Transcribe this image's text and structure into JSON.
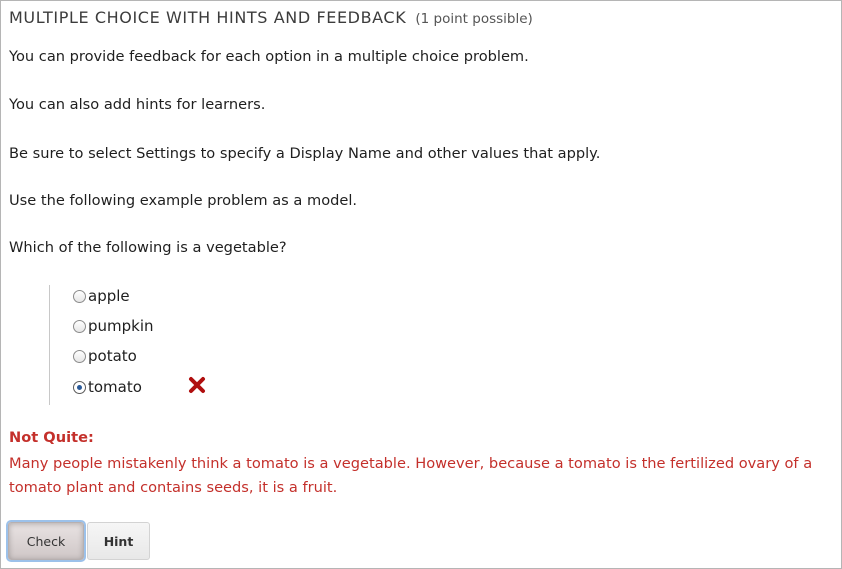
{
  "problem": {
    "title": "MULTIPLE CHOICE WITH HINTS AND FEEDBACK",
    "points": "(1 point possible)"
  },
  "paragraphs": [
    "You can provide feedback for each option in a multiple choice problem.",
    "You can also add hints for learners.",
    "Be sure to select Settings to specify a Display Name and other values that apply.",
    "Use the following example problem as a model.",
    "Which of the following is a vegetable?"
  ],
  "choices": [
    {
      "label": "apple",
      "selected": false
    },
    {
      "label": "pumpkin",
      "selected": false
    },
    {
      "label": "potato",
      "selected": false
    },
    {
      "label": "tomato",
      "selected": true
    }
  ],
  "status_icon": "incorrect-x-icon",
  "feedback": {
    "heading": "Not Quite:",
    "message": "Many people mistakenly think a tomato is a vegetable. However, because a tomato is the fertilized ovary of a tomato plant and contains seeds, it is a fruit."
  },
  "buttons": {
    "check_label": "Check",
    "hint_label": "Hint"
  },
  "colors": {
    "feedback_red": "#c4302b",
    "x_icon_red": "#b00e0e",
    "focus_ring": "#9cc1ea"
  }
}
